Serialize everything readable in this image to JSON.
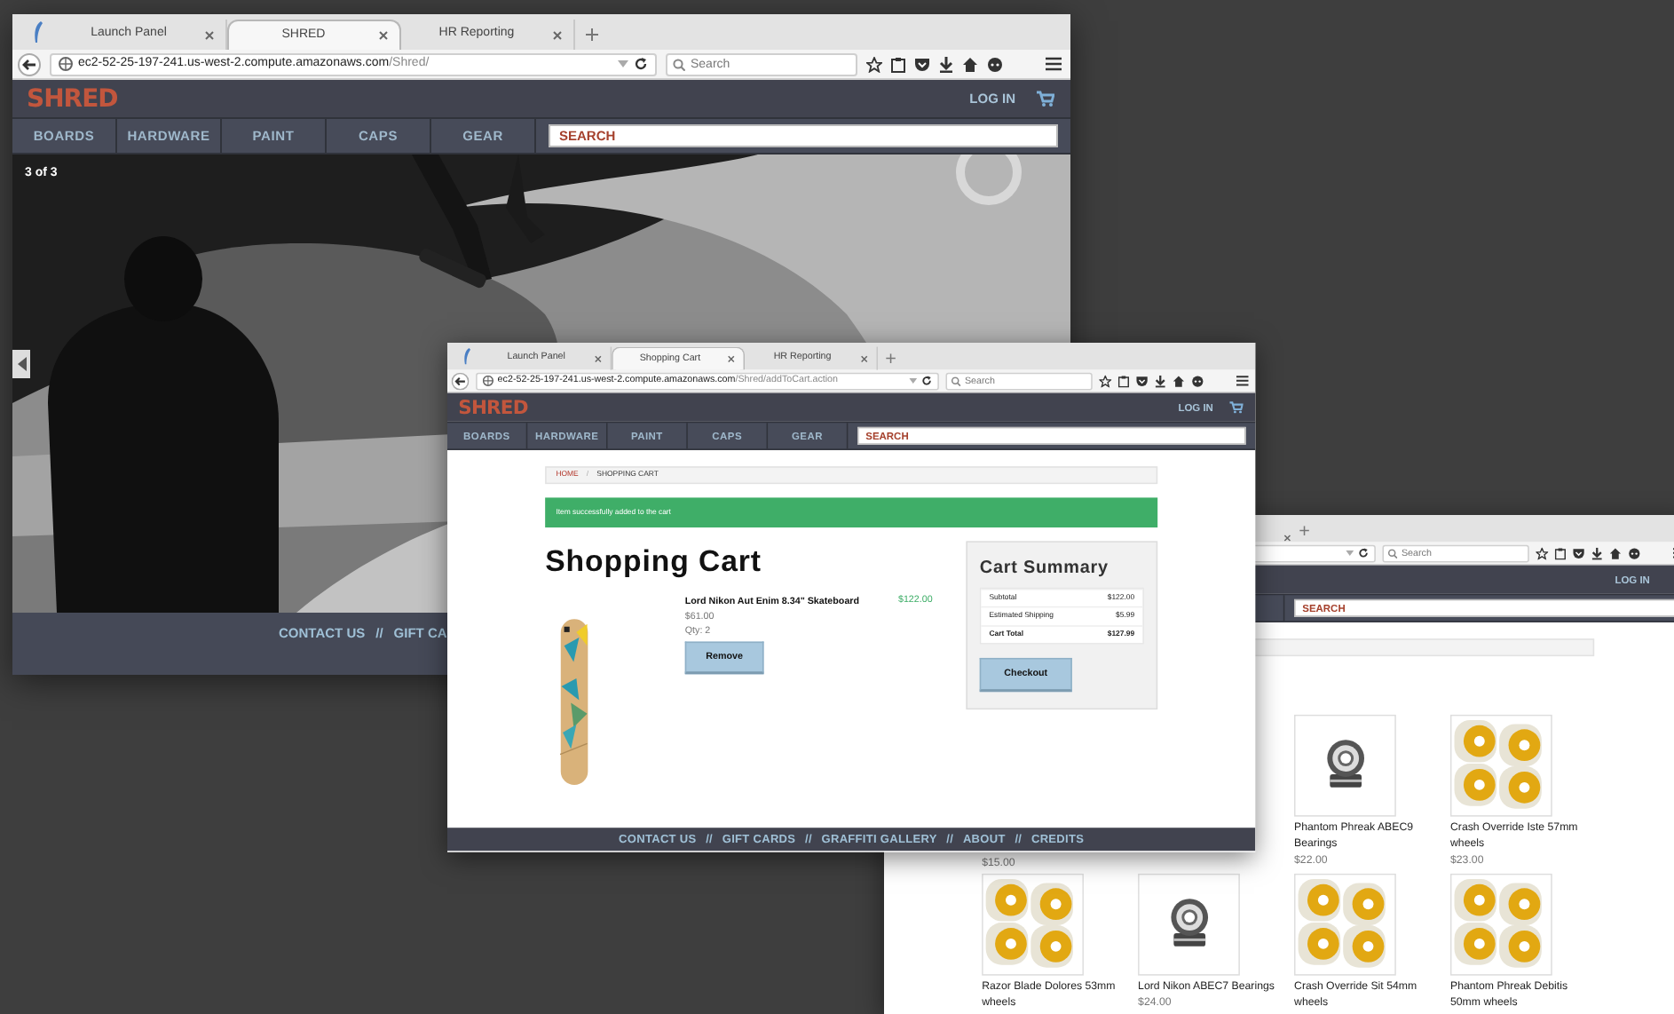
{
  "windows": [
    {
      "kind": "home",
      "tabs": [
        {
          "label": "Launch Panel",
          "selected": false
        },
        {
          "label": "SHRED",
          "selected": true
        },
        {
          "label": "HR Reporting",
          "selected": false
        }
      ],
      "address": {
        "host": "ec2-52-25-197-241.us-west-2.compute.amazonaws.com",
        "path": "/Shred/"
      },
      "browser_search": {
        "placeholder": "Search"
      },
      "site": {
        "logo": "SHRED",
        "login": "LOG IN",
        "nav": [
          "BOARDS",
          "HARDWARE",
          "PAINT",
          "CAPS",
          "GEAR"
        ],
        "search": {
          "placeholder": "SEARCH"
        }
      },
      "slide_counter": "3 of 3",
      "footer": [
        "CONTACT US",
        "//",
        "GIFT CA"
      ]
    },
    {
      "kind": "cart",
      "tabs": [
        {
          "label": "Launch Panel",
          "selected": false
        },
        {
          "label": "Shopping Cart",
          "selected": true
        },
        {
          "label": "HR Reporting",
          "selected": false
        }
      ],
      "address": {
        "host": "ec2-52-25-197-241.us-west-2.compute.amazonaws.com",
        "path": "/Shred/addToCart.action"
      },
      "browser_search": {
        "placeholder": "Search"
      },
      "site": {
        "logo": "SHRED",
        "login": "LOG IN",
        "nav": [
          "BOARDS",
          "HARDWARE",
          "PAINT",
          "CAPS",
          "GEAR"
        ],
        "search": {
          "placeholder": "SEARCH"
        }
      },
      "breadcrumb": {
        "items": [
          {
            "label": "HOME",
            "kind": "link"
          },
          {
            "label": "SHOPPING CART",
            "kind": "current"
          }
        ],
        "separator": "/"
      },
      "alert": "Item successfully added to the cart",
      "heading": "Shopping Cart",
      "items": [
        {
          "name": "Lord Nikon Aut Enim 8.34\" Skateboard",
          "total": "$122.00",
          "unit_price": "$61.00",
          "quantity": "Qty: 2",
          "action": "Remove"
        }
      ],
      "summary": {
        "title": "Cart Summary",
        "rows": [
          {
            "label": "Subtotal",
            "value": "$122.00",
            "kind": "line"
          },
          {
            "label": "Estimated Shipping",
            "value": "$5.99",
            "kind": "line"
          },
          {
            "label": "Cart Total",
            "value": "$127.99",
            "kind": "total"
          }
        ],
        "action": "Checkout"
      },
      "footer": [
        "CONTACT US",
        "//",
        "GIFT CARDS",
        "//",
        "GRAFFITI GALLERY",
        "//",
        "ABOUT",
        "//",
        "CREDITS"
      ]
    },
    {
      "kind": "catalog",
      "browser_search": {
        "placeholder": "Search"
      },
      "site": {
        "login": "LOG IN",
        "search": {
          "placeholder": "SEARCH"
        }
      },
      "products": [
        {
          "price": "$15.00"
        },
        {
          "kind": "bearing",
          "name": "Phantom Phreak ABEC9 Bearings",
          "price": "$22.00"
        },
        {
          "kind": "wheels",
          "name": "Crash Override Iste 57mm wheels",
          "price": "$23.00"
        },
        {
          "kind": "wheels",
          "name": "Razor Blade Dolores 53mm wheels"
        },
        {
          "kind": "bearing",
          "name": "Lord Nikon ABEC7 Bearings",
          "price": "$24.00"
        },
        {
          "kind": "wheels",
          "name": "Crash Override Sit 54mm wheels"
        },
        {
          "kind": "wheels",
          "name": "Phantom Phreak Debitis 50mm wheels"
        }
      ]
    }
  ]
}
